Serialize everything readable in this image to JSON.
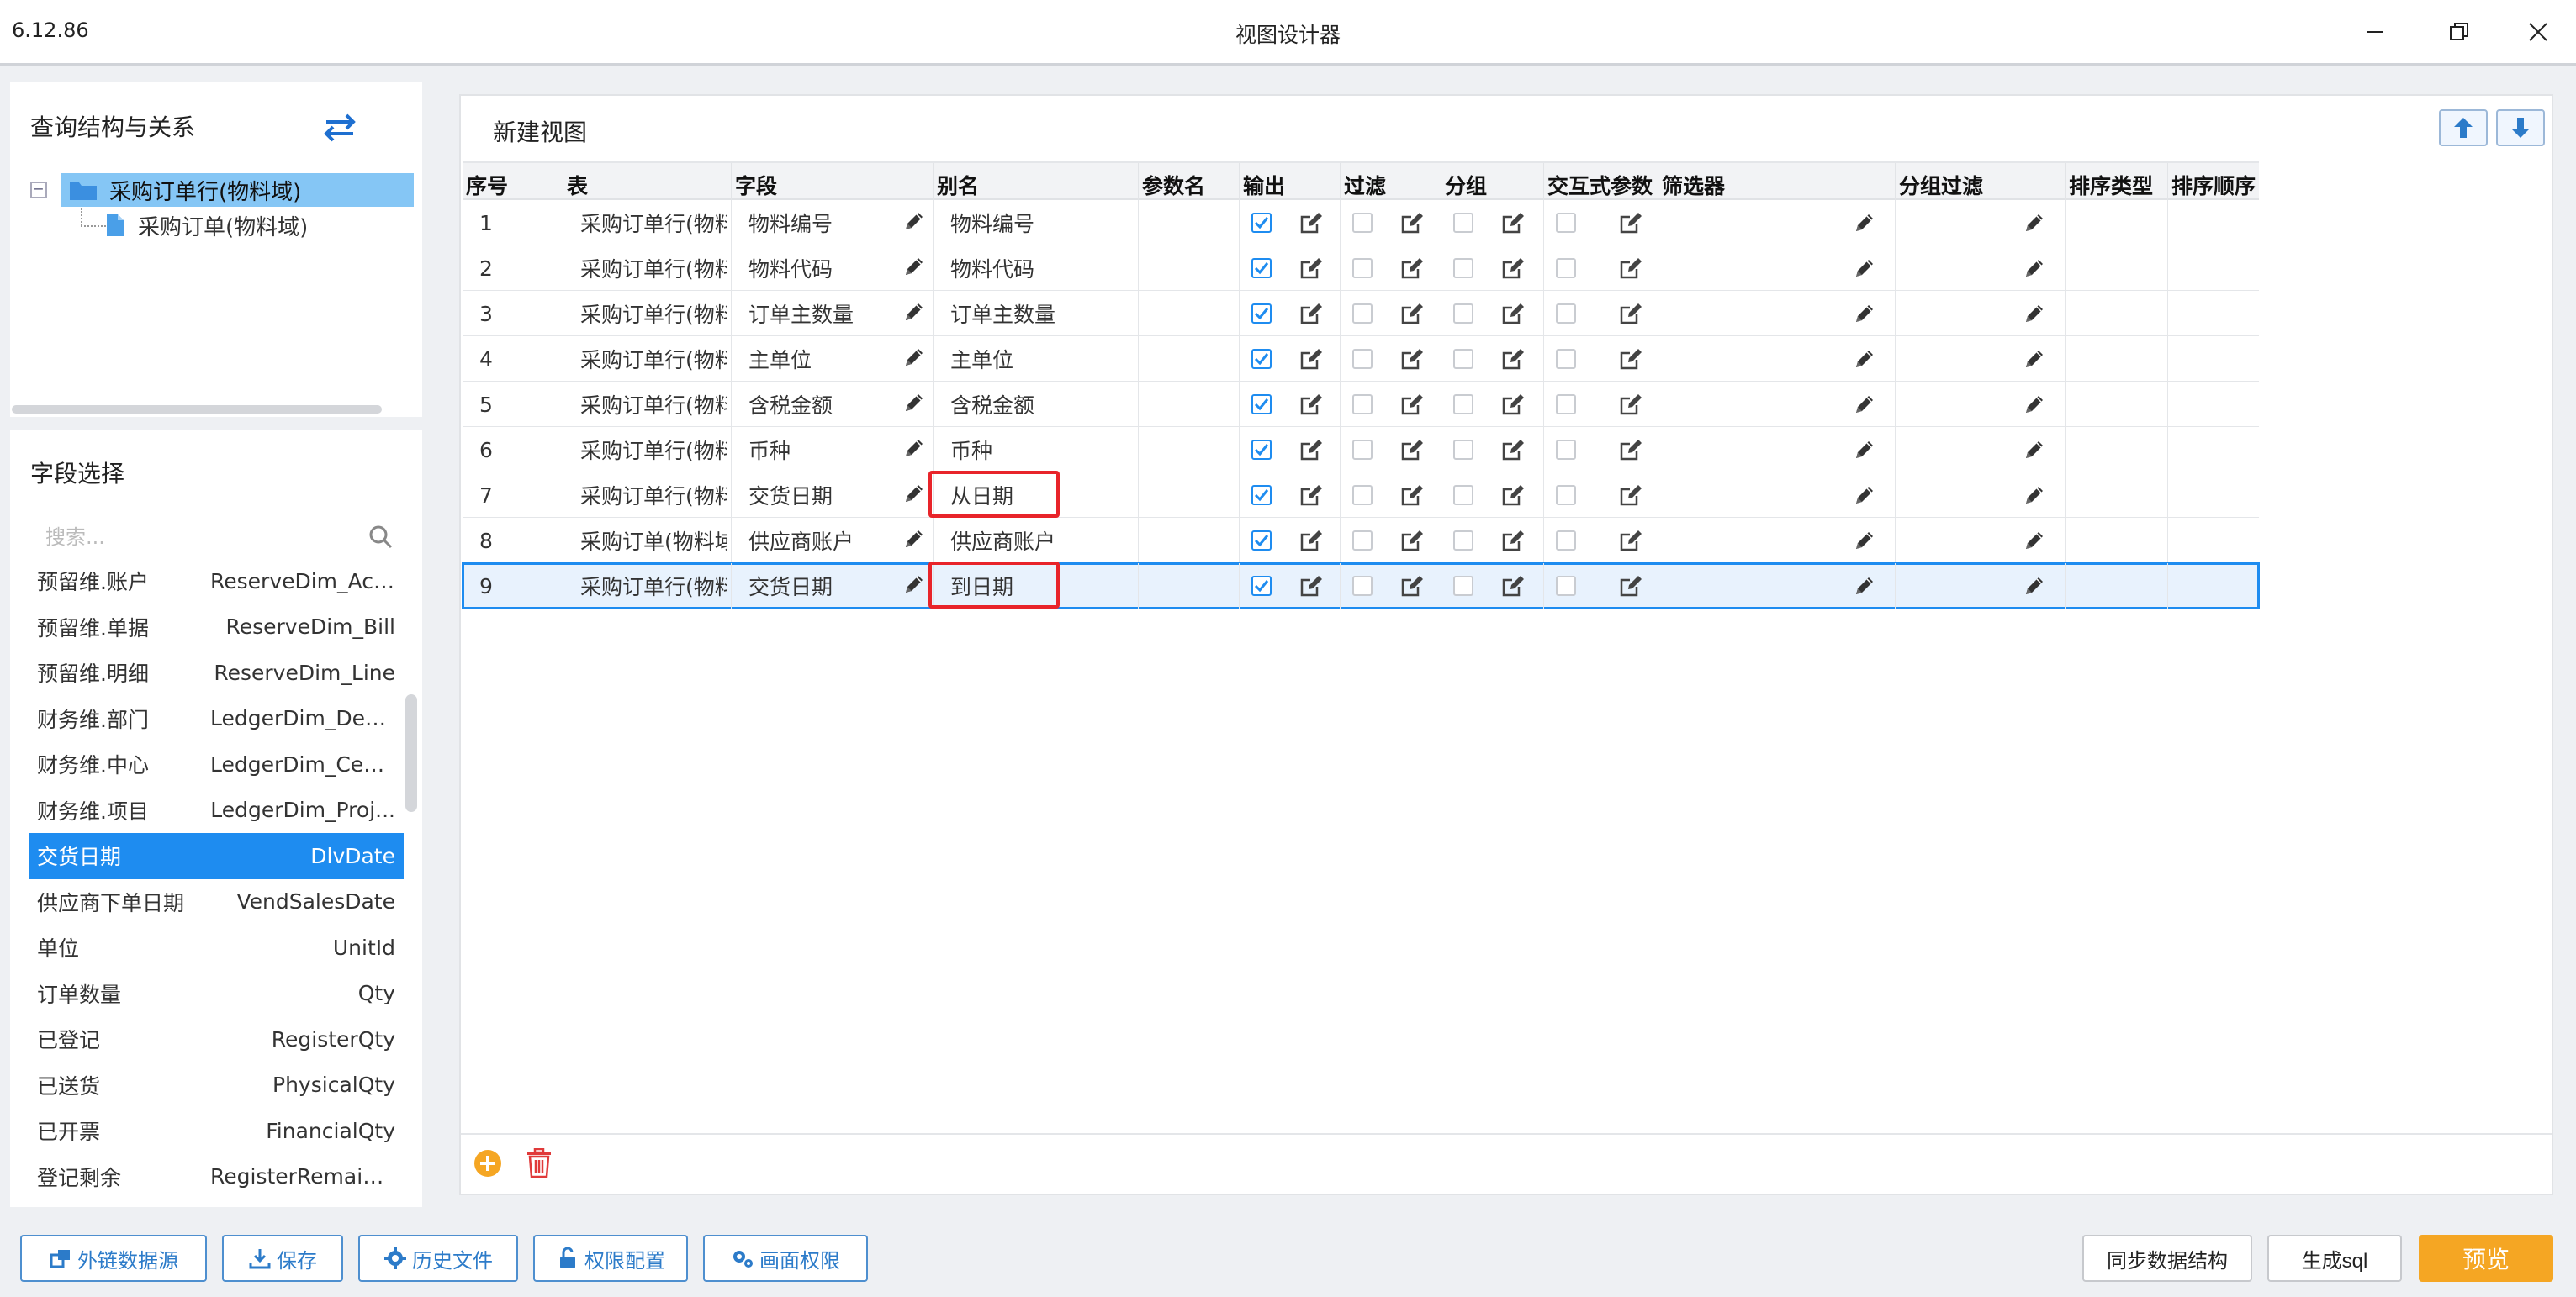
{
  "window": {
    "version": "6.12.86",
    "title": "视图设计器"
  },
  "query_panel": {
    "title": "查询结构与关系",
    "tree": {
      "root": "采购订单行(物料域)",
      "child": "采购订单(物料域)"
    }
  },
  "field_panel": {
    "title": "字段选择",
    "search_placeholder": "搜索...",
    "fields": [
      {
        "name": "预留维.账户",
        "code": "ReserveDim_Acc..."
      },
      {
        "name": "预留维.单据",
        "code": "ReserveDim_Bill"
      },
      {
        "name": "预留维.明细",
        "code": "ReserveDim_Line"
      },
      {
        "name": "财务维.部门",
        "code": "LedgerDim_Dep..."
      },
      {
        "name": "财务维.中心",
        "code": "LedgerDim_Cent..."
      },
      {
        "name": "财务维.项目",
        "code": "LedgerDim_Proj..."
      },
      {
        "name": "交货日期",
        "code": "DlvDate"
      },
      {
        "name": "供应商下单日期",
        "code": "VendSalesDate"
      },
      {
        "name": "单位",
        "code": "UnitId"
      },
      {
        "name": "订单数量",
        "code": "Qty"
      },
      {
        "name": "已登记",
        "code": "RegisterQty"
      },
      {
        "name": "已送货",
        "code": "PhysicalQty"
      },
      {
        "name": "已开票",
        "code": "FinancialQty"
      },
      {
        "name": "登记剩余",
        "code": "RegisterRemainQty"
      }
    ],
    "selected_index": 6
  },
  "main": {
    "title": "新建视图",
    "columns": [
      "序号",
      "表",
      "字段",
      "别名",
      "参数名",
      "输出",
      "过滤",
      "分组",
      "交互式参数",
      "筛选器",
      "分组过滤",
      "排序类型",
      "排序顺序"
    ],
    "rows": [
      {
        "seq": "1",
        "table": "采购订单行(物料域)",
        "field": "物料编号",
        "alias": "物料编号",
        "output": true
      },
      {
        "seq": "2",
        "table": "采购订单行(物料域)",
        "field": "物料代码",
        "alias": "物料代码",
        "output": true
      },
      {
        "seq": "3",
        "table": "采购订单行(物料域)",
        "field": "订单主数量",
        "alias": "订单主数量",
        "output": true
      },
      {
        "seq": "4",
        "table": "采购订单行(物料域)",
        "field": "主单位",
        "alias": "主单位",
        "output": true
      },
      {
        "seq": "5",
        "table": "采购订单行(物料域)",
        "field": "含税金额",
        "alias": "含税金额",
        "output": true
      },
      {
        "seq": "6",
        "table": "采购订单行(物料域)",
        "field": "币种",
        "alias": "币种",
        "output": true
      },
      {
        "seq": "7",
        "table": "采购订单行(物料域)",
        "field": "交货日期",
        "alias": "从日期",
        "output": true
      },
      {
        "seq": "8",
        "table": "采购订单(物料域)",
        "field": "供应商账户",
        "alias": "供应商账户",
        "output": true
      },
      {
        "seq": "9",
        "table": "采购订单行(物料域)",
        "field": "交货日期",
        "alias": "到日期",
        "output": true
      }
    ],
    "selected_row": 8,
    "highlighted_rows": [
      6,
      8
    ]
  },
  "toolbar": {
    "external_source": "外链数据源",
    "save": "保存",
    "history": "历史文件",
    "permission_config": "权限配置",
    "screen_permission": "画面权限",
    "sync_structure": "同步数据结构",
    "generate_sql": "生成sql",
    "preview": "预览"
  },
  "colors": {
    "accent": "#1e8cf0",
    "tree_selected": "#85c6f5",
    "preview": "#f5a623",
    "highlight": "#e8242a"
  }
}
